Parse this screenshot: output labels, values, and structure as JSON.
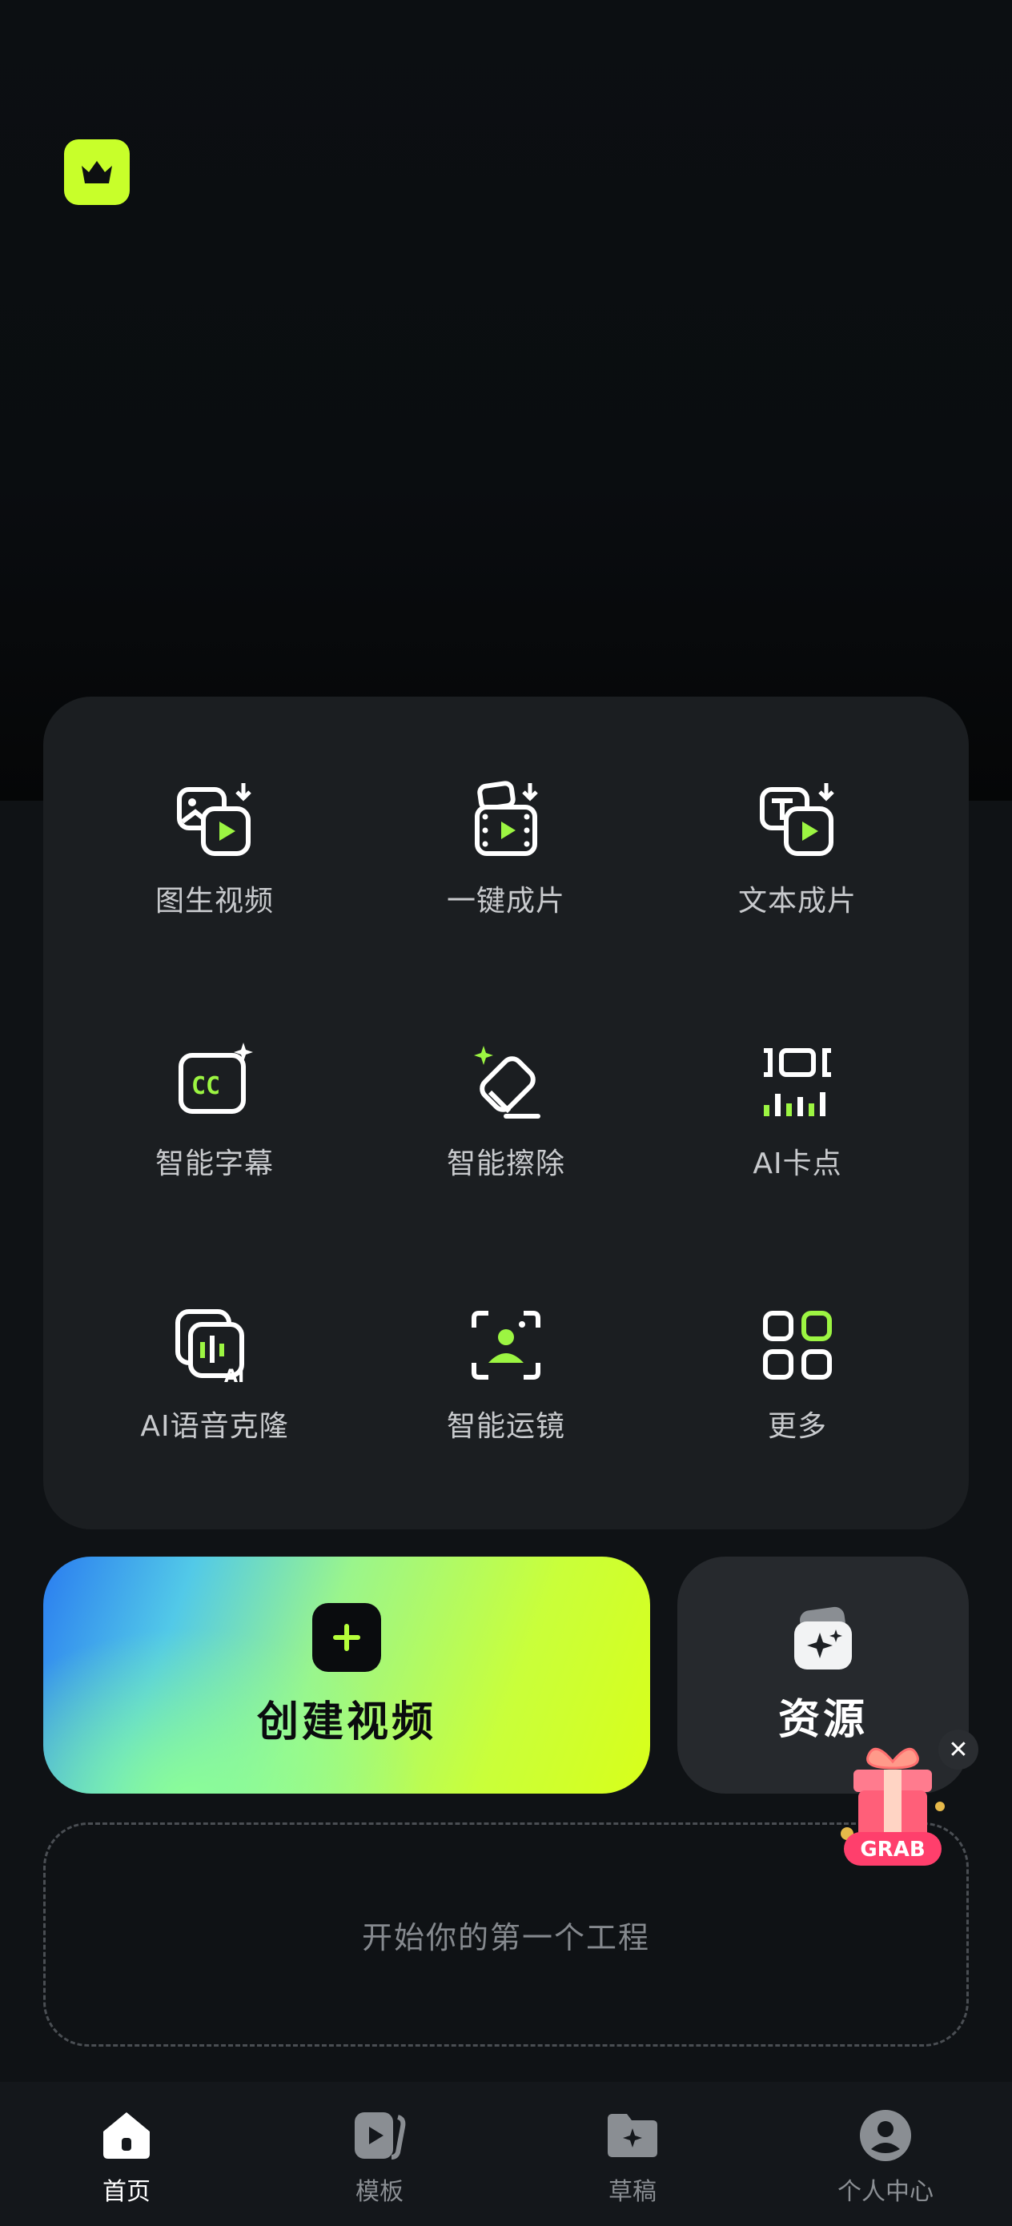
{
  "header": {
    "vip_icon": "crown-icon"
  },
  "tools": [
    {
      "label": "图生视频",
      "icon": "image-to-video-icon"
    },
    {
      "label": "一键成片",
      "icon": "one-click-video-icon"
    },
    {
      "label": "文本成片",
      "icon": "text-to-video-icon"
    },
    {
      "label": "智能字幕",
      "icon": "auto-captions-icon"
    },
    {
      "label": "智能擦除",
      "icon": "smart-erase-icon"
    },
    {
      "label": "AI卡点",
      "icon": "ai-beat-sync-icon"
    },
    {
      "label": "AI语音克隆",
      "icon": "ai-voice-clone-icon"
    },
    {
      "label": "智能运镜",
      "icon": "smart-camera-icon"
    },
    {
      "label": "更多",
      "icon": "more-grid-icon"
    }
  ],
  "create": {
    "label": "创建视频",
    "icon": "plus-icon"
  },
  "resources": {
    "label": "资源",
    "icon": "sparkle-card-icon"
  },
  "promo": {
    "badge": "GRAB",
    "close": "✕"
  },
  "empty_state": {
    "label": "开始你的第一个工程"
  },
  "tabbar": {
    "tabs": [
      {
        "label": "首页",
        "icon": "home-icon",
        "active": true
      },
      {
        "label": "模板",
        "icon": "template-icon",
        "active": false
      },
      {
        "label": "草稿",
        "icon": "drafts-folder-icon",
        "active": false
      },
      {
        "label": "个人中心",
        "icon": "profile-icon",
        "active": false
      }
    ]
  },
  "colors": {
    "accent": "#c8ff2a",
    "accent_green": "#9cf542",
    "panel": "#1b1e21",
    "background": "#0b0e12"
  }
}
